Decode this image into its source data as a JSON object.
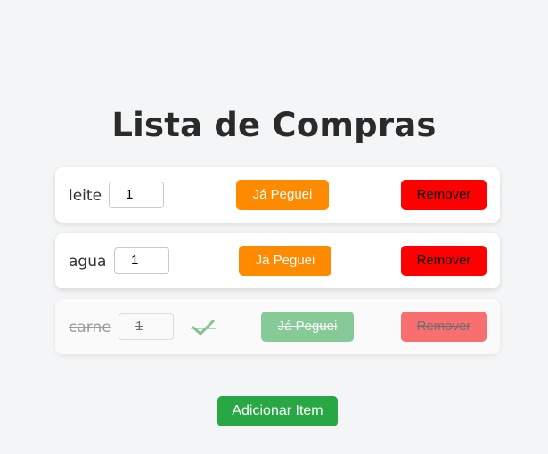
{
  "page": {
    "title": "Lista de Compras",
    "add_button_label": "Adicionar Item"
  },
  "items": [
    {
      "name": "leite",
      "quantity": "1",
      "checked": false,
      "got_label": "Já Peguei",
      "remove_label": "Remover"
    },
    {
      "name": "agua",
      "quantity": "1",
      "checked": false,
      "got_label": "Já Peguei",
      "remove_label": "Remover"
    },
    {
      "name": "carne",
      "quantity": "1",
      "checked": true,
      "got_label": "Já Peguei",
      "remove_label": "Remover"
    }
  ],
  "colors": {
    "background": "#f4f5f6",
    "got_button": "#fe8a00",
    "got_button_checked": "#2ba84a",
    "remove_button": "#fe0000",
    "add_button": "#28a745",
    "checkmark": "#2e9a3e"
  },
  "icons": {
    "checked_item": "checkmark-icon"
  }
}
